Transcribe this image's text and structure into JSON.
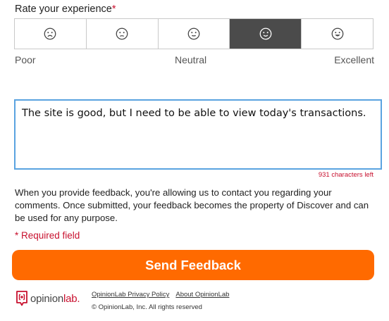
{
  "rating": {
    "title": "Rate your experience",
    "required_mark": "*",
    "options": [
      {
        "icon": "very-sad-face-icon",
        "selected": false
      },
      {
        "icon": "sad-face-icon",
        "selected": false
      },
      {
        "icon": "neutral-face-icon",
        "selected": false
      },
      {
        "icon": "smile-face-icon",
        "selected": true
      },
      {
        "icon": "big-smile-face-icon",
        "selected": false
      }
    ],
    "scale_labels": {
      "low": "Poor",
      "mid": "Neutral",
      "high": "Excellent"
    }
  },
  "comment": {
    "value": "The site is good, but I need to be able to view today's transactions.",
    "chars_left": "931 characters left"
  },
  "disclaimer": "When you provide feedback, you're allowing us to contact you regarding your comments. Once submitted, your feedback becomes the property of Discover and can be used for any purpose.",
  "required_note": "* Required field",
  "submit_label": "Send Feedback",
  "footer": {
    "brand_prefix": "opinion",
    "brand_suffix": "lab.",
    "privacy_link": "OpinionLab Privacy Policy",
    "about_link": "About OpinionLab",
    "copyright": "© OpinionLab, Inc. All rights reserved"
  },
  "colors": {
    "accent": "#ff6a00",
    "required": "#c8102e",
    "selected_cell": "#4b4b4b",
    "focus_border": "#5aa3e0"
  }
}
